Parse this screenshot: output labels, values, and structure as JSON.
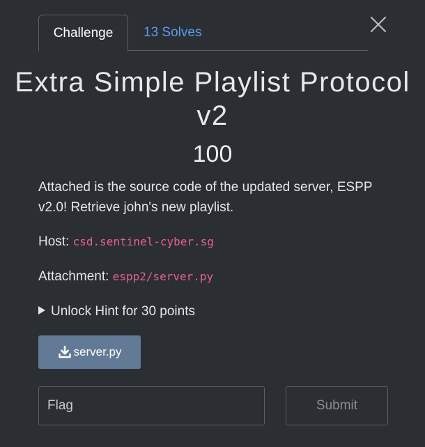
{
  "tabs": {
    "challenge_label": "Challenge",
    "solves_label": "13 Solves"
  },
  "challenge": {
    "title": "Extra Simple Playlist Protocol v2",
    "points": "100",
    "description": "Attached is the source code of the updated server, ESPP v2.0! Retrieve john's new playlist.",
    "host_label": "Host:",
    "host_value": "csd.sentinel-cyber.sg",
    "attachment_label": "Attachment:",
    "attachment_value": "espp2/server.py",
    "hint_label": "Unlock Hint for 30 points"
  },
  "download": {
    "label": "server.py",
    "icon": "download-icon"
  },
  "flag_form": {
    "placeholder": "Flag",
    "value": "",
    "submit_label": "Submit"
  },
  "icons": {
    "close": "close-icon",
    "hint_toggle": "caret-right-icon"
  },
  "colors": {
    "background": "#2b2e33",
    "accent_link": "#5b9ee8",
    "code_pink": "#e85e9c",
    "download_button": "#627a96",
    "border": "#5a5f66"
  }
}
